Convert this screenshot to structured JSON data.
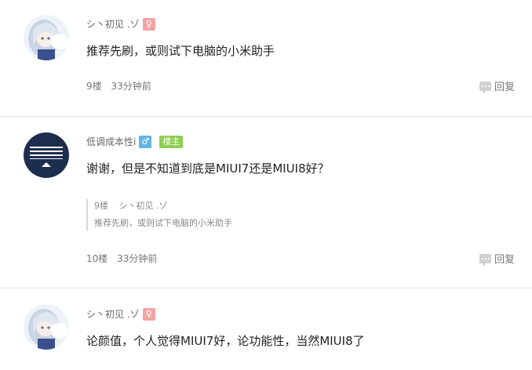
{
  "posts": [
    {
      "username": "シ丶初见 .ゾ",
      "gender_icon": "female-icon",
      "gender_symbol": "♀",
      "content": "推荐先刷，或则试下电脑的小米助手",
      "floor": "9楼",
      "time": "33分钟前",
      "reply_label": "回复"
    },
    {
      "username": "低调成本性i",
      "gender_icon": "male-icon",
      "gender_symbol": "♂",
      "owner_badge": "楼主",
      "content": "谢谢，但是不知道到底是MIUI7还是MIUI8好？",
      "quote": {
        "floor": "9楼",
        "username": "シ丶初见 .ゾ",
        "text": "推荐先刷，或则试下电脑的小米助手"
      },
      "floor": "10楼",
      "time": "33分钟前",
      "reply_label": "回复"
    },
    {
      "username": "シ丶初见 .ゾ",
      "gender_icon": "female-icon",
      "gender_symbol": "♀",
      "content": "论颜值，个人觉得MIUI7好，论功能性，当然MIUI8了"
    }
  ],
  "colors": {
    "female": "#f2a4a4",
    "male": "#62b5e5",
    "owner": "#8bd04f",
    "divider": "#e6e6e6"
  }
}
